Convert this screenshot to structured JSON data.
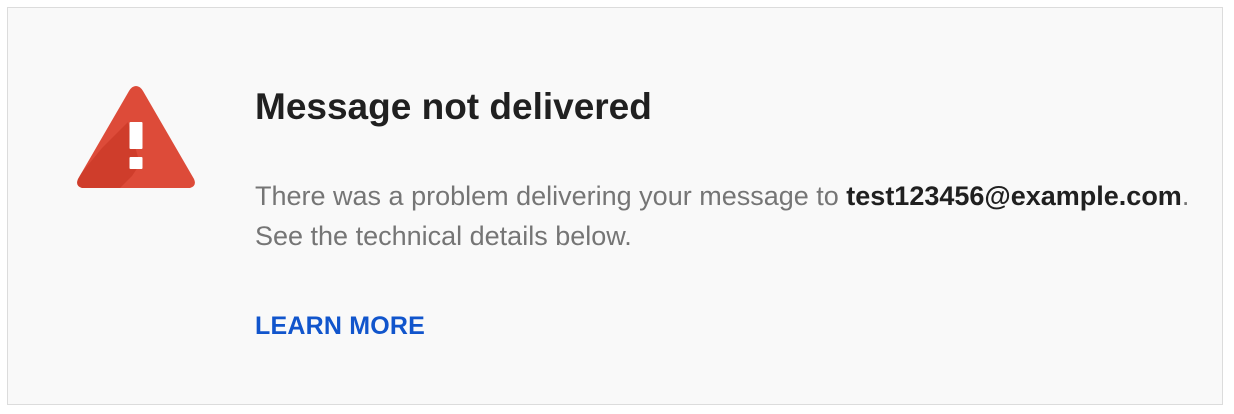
{
  "error_card": {
    "icon": "warning-triangle-icon",
    "icon_color": "#dd4b39",
    "icon_shadow_color": "#c23321",
    "title": "Message not delivered",
    "message_prefix": "There was a problem delivering your message to ",
    "recipient": "test123456@example.com",
    "message_suffix": ". See the technical details below.",
    "learn_more_label": "LEARN MORE",
    "link_color": "#1155cc"
  }
}
